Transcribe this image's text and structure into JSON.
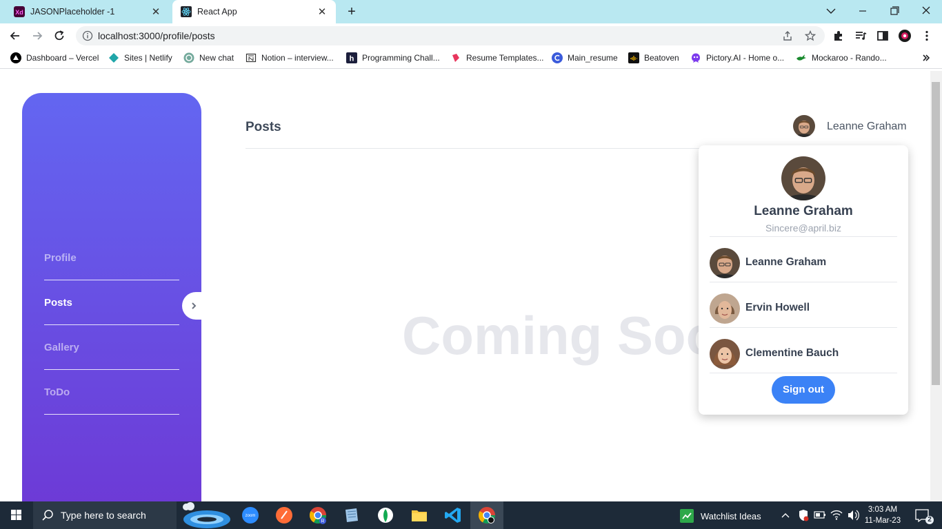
{
  "browser": {
    "tabs": [
      {
        "title": "JASONPlaceholder -1",
        "icon": "adobe-xd-icon",
        "active": false
      },
      {
        "title": "React App",
        "icon": "react-icon",
        "active": true
      }
    ],
    "url": "localhost:3000/profile/posts",
    "bookmarks": [
      {
        "label": "Dashboard – Vercel",
        "icon": "vercel-icon"
      },
      {
        "label": "Sites | Netlify",
        "icon": "netlify-icon"
      },
      {
        "label": "New chat",
        "icon": "openai-icon"
      },
      {
        "label": "Notion – interview...",
        "icon": "notion-icon"
      },
      {
        "label": "Programming Chall...",
        "icon": "hackerrank-icon"
      },
      {
        "label": "Resume Templates...",
        "icon": "resume-icon"
      },
      {
        "label": "Main_resume",
        "icon": "canva-icon"
      },
      {
        "label": "Beatoven",
        "icon": "beatoven-icon"
      },
      {
        "label": "Pictory.AI - Home o...",
        "icon": "pictory-icon"
      },
      {
        "label": "Mockaroo - Rando...",
        "icon": "mockaroo-icon"
      }
    ]
  },
  "sidebar": {
    "items": [
      {
        "label": "Profile",
        "active": false
      },
      {
        "label": "Posts",
        "active": true
      },
      {
        "label": "Gallery",
        "active": false
      },
      {
        "label": "ToDo",
        "active": false
      }
    ]
  },
  "header": {
    "title": "Posts",
    "user_name": "Leanne Graham"
  },
  "main": {
    "placeholder": "Coming Soon"
  },
  "dropdown": {
    "name": "Leanne Graham",
    "email": "Sincere@april.biz",
    "accounts": [
      {
        "name": "Leanne Graham"
      },
      {
        "name": "Ervin Howell"
      },
      {
        "name": "Clementine Bauch"
      }
    ],
    "signout_label": "Sign out"
  },
  "taskbar": {
    "search_placeholder": "Type here to search",
    "widget": "Watchlist Ideas",
    "time": "3:03 AM",
    "date": "11-Mar-23",
    "notifications": "2"
  },
  "colors": {
    "sidebar_top": "#6366f1",
    "sidebar_bottom": "#6d3ad6",
    "accent": "#3b82f6",
    "tabbar": "#b9e8f1",
    "taskbar": "#1d2a38"
  }
}
